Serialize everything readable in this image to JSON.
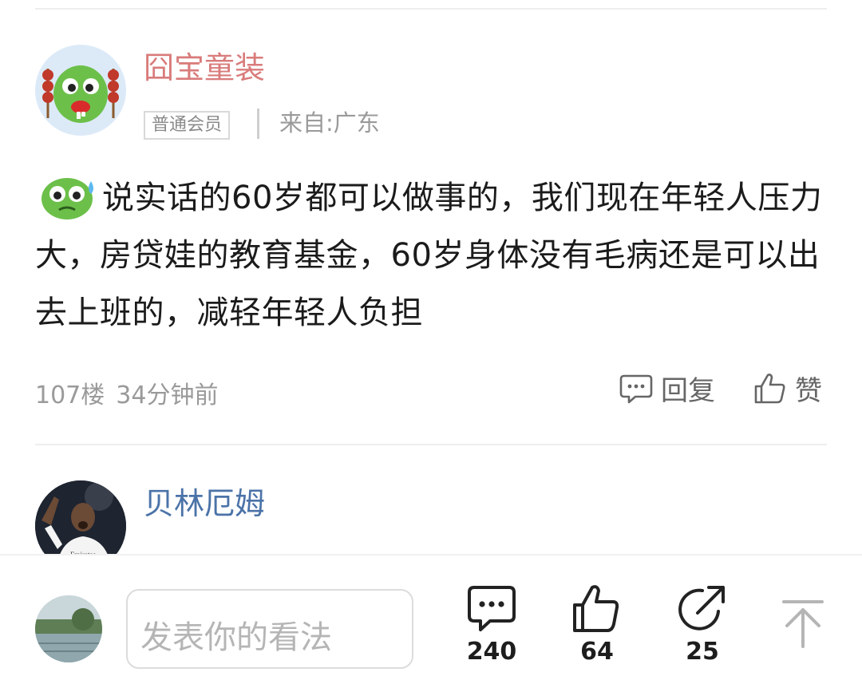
{
  "comments": [
    {
      "username": "囧宝童装",
      "username_color": "#d97b7b",
      "badge": "普通会员",
      "location": "来自:广东",
      "text": "说实话的60岁都可以做事的，我们现在年轻人压力大，房贷娃的教育基金，60岁身体没有毛病还是可以出去上班的，减轻年轻人负担",
      "floor": "107楼",
      "time": "34分钟前",
      "reply_label": "回复",
      "like_label": "赞"
    },
    {
      "username": "贝林厄姆",
      "username_color": "#4b73a8",
      "jersey_text": "Emirates"
    }
  ],
  "bottom_bar": {
    "input_placeholder": "发表你的看法",
    "comments_count": "240",
    "likes_count": "64",
    "shares_count": "25"
  },
  "icons": {
    "reply": "comment-bubble-icon",
    "like": "thumbs-up-icon",
    "share": "share-icon",
    "back_to_top": "arrow-up-icon"
  }
}
